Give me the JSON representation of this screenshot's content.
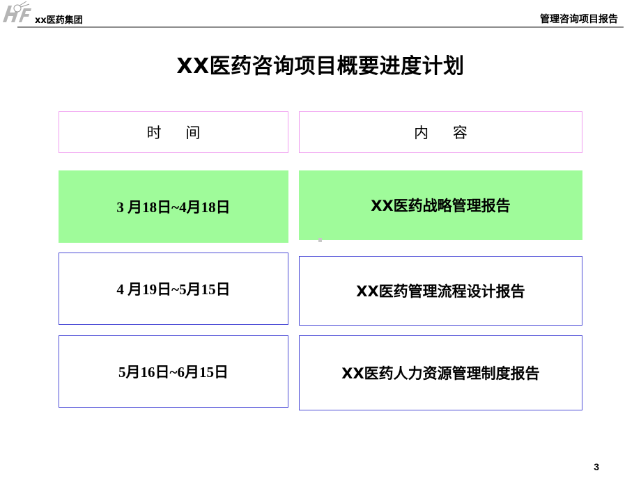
{
  "header": {
    "company": "xx医药集团",
    "report_name": "管理咨询项目报告"
  },
  "title": "XX医药咨询项目概要进度计划",
  "table": {
    "headers": {
      "time": "时 间",
      "content": "内 容"
    },
    "rows": [
      {
        "time": "3 月18日~4月18日",
        "content": "XX医药战略管理报告",
        "highlighted": true
      },
      {
        "time": "4 月19日~5月15日",
        "content": "XX医药管理流程设计报告",
        "highlighted": false
      },
      {
        "time": "5月16日~6月15日",
        "content": "XX医药人力资源管理制度报告",
        "highlighted": false
      }
    ]
  },
  "colors": {
    "header_border": "#f09cf0",
    "highlight_fill": "#9ffb9a",
    "row_border": "#4b4bd6",
    "rule": "#8c8c8c"
  },
  "page_number": "3"
}
